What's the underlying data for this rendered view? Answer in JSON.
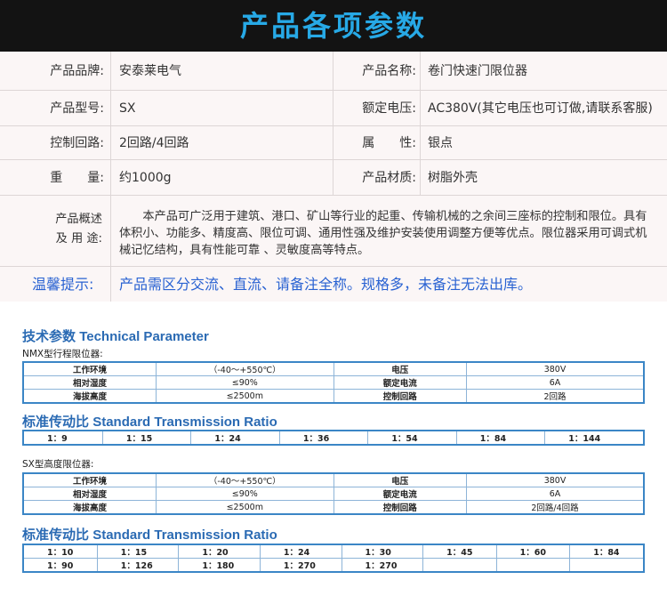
{
  "header": {
    "title": "产品各项参数"
  },
  "spec": {
    "rows": [
      {
        "l1": "产品品牌:",
        "v1": "安泰莱电气",
        "l2": "产品名称:",
        "v2": "卷门快速门限位器"
      },
      {
        "l1": "产品型号:",
        "v1": "SX",
        "l2": "额定电压:",
        "v2": "AC380V(其它电压也可订做,请联系客服)"
      },
      {
        "l1": "控制回路:",
        "v1": "2回路/4回路",
        "l2": "属　　性:",
        "v2": "银点"
      },
      {
        "l1": "重　　量:",
        "v1": "约1000g",
        "l2": "产品材质:",
        "v2": "树脂外壳"
      }
    ],
    "overview_label_1": "产品概述",
    "overview_label_2": "及 用 途:",
    "overview_text": "　　本产品可广泛用于建筑、港口、矿山等行业的起重、传输机械的之余间三座标的控制和限位。具有体积小、功能多、精度高、限位可调、通用性强及维护安装使用调整方便等优点。限位器采用可调式机械记忆结构，具有性能可靠 、灵敏度高等特点。",
    "tip_label": "温馨提示:",
    "tip_text": "产品需区分交流、直流、请备注全称。规格多，未备注无法出库。"
  },
  "tech": {
    "title_cn": "技术参数",
    "title_en": "Technical Parameter",
    "nmx": {
      "subtitle": "NMX型行程限位器:",
      "rows": [
        [
          "工作环境",
          "（-40～+550℃）",
          "电压",
          "380V"
        ],
        [
          "相对湿度",
          "≤90%",
          "额定电流",
          "6A"
        ],
        [
          "海拔高度",
          "≤2500m",
          "控制回路",
          "2回路"
        ]
      ]
    },
    "ratio_title_cn": "标准传动比",
    "ratio_title_en": "Standard Transmission Ratio",
    "nmx_ratios": [
      "1：9",
      "1：15",
      "1：24",
      "1：36",
      "1：54",
      "1：84",
      "1：144"
    ],
    "sx": {
      "subtitle": "SX型高度限位器:",
      "rows": [
        [
          "工作环境",
          "（-40～+550℃）",
          "电压",
          "380V"
        ],
        [
          "相对湿度",
          "≤90%",
          "额定电流",
          "6A"
        ],
        [
          "海拔高度",
          "≤2500m",
          "控制回路",
          "2回路/4回路"
        ]
      ]
    },
    "sx_ratios_row1": [
      "1：10",
      "1：15",
      "1：20",
      "1：24",
      "1：30",
      "1：45",
      "1：60",
      "1：84"
    ],
    "sx_ratios_row2": [
      "1：90",
      "1：126",
      "1：180",
      "1：270",
      "1：270",
      "",
      "",
      ""
    ]
  }
}
